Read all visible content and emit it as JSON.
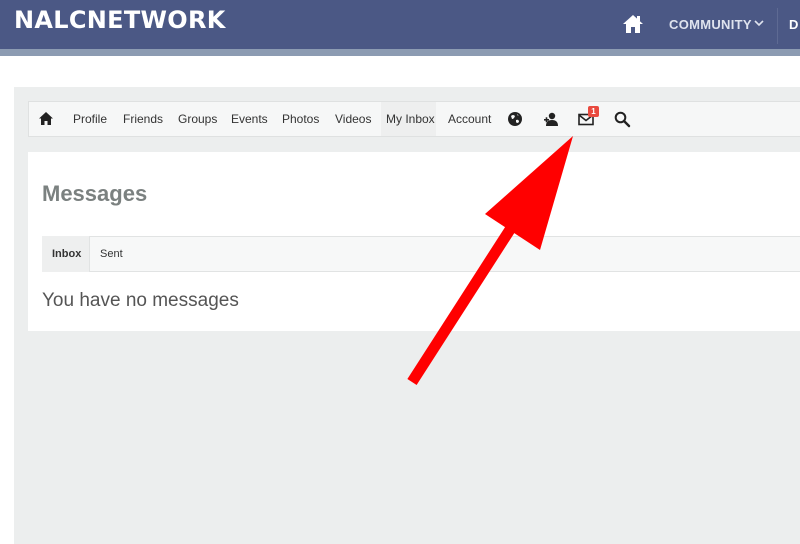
{
  "header": {
    "logo": "NALCNETWORK",
    "community_label": "COMMUNITY",
    "truncated_item": "D"
  },
  "nav": {
    "items": [
      "Profile",
      "Friends",
      "Groups",
      "Events",
      "Photos",
      "Videos",
      "My Inbox",
      "Account"
    ],
    "icons": [
      "home-icon",
      "globe-icon",
      "user-add-icon",
      "mail-icon",
      "search-icon"
    ],
    "inbox_badge": "1"
  },
  "messages": {
    "title": "Messages",
    "tabs": [
      "Inbox",
      "Sent"
    ],
    "empty_text": "You have no messages"
  },
  "colors": {
    "header_bg": "#4b5885",
    "badge": "#e94a3f",
    "arrow": "#ff0000"
  }
}
